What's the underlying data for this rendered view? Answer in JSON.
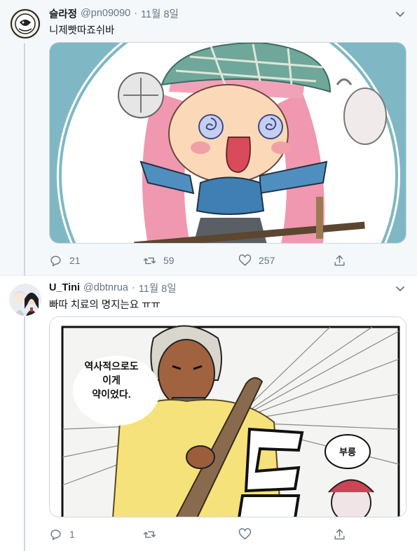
{
  "tweets": [
    {
      "name": "슬라정",
      "handle": "@pn09090",
      "separator": "·",
      "date": "11월 8일",
      "text": "니제빳따죠쉬바",
      "actions": {
        "reply": "21",
        "retweet": "59",
        "like": "257"
      },
      "icons": {
        "reply": "speech-bubble-icon",
        "retweet": "retweet-arrows-icon",
        "like": "heart-icon",
        "share": "share-upload-icon",
        "menu": "chevron-down-icon"
      }
    },
    {
      "name": "U_Tini",
      "handle": "@dbtnrua",
      "separator": "·",
      "date": "11월 8일",
      "text": "빠따 치료의 명지는요 ㅠㅠ",
      "actions": {
        "reply": "1",
        "retweet": "",
        "like": ""
      },
      "speech_bubble_1": [
        "역사적으로도",
        "이게",
        "약이었다."
      ],
      "speech_bubble_2": "부릉",
      "icons": {
        "reply": "speech-bubble-icon",
        "retweet": "retweet-arrows-icon",
        "like": "heart-icon",
        "share": "share-upload-icon",
        "menu": "chevron-down-icon"
      }
    }
  ],
  "colors": {
    "thread_line": "#ccd6dd",
    "muted": "#657786",
    "text": "#14171a",
    "selected_bg": "#f5f8fa",
    "image_teal": "#7fb8c4",
    "hair_pink": "#ef98b0"
  }
}
